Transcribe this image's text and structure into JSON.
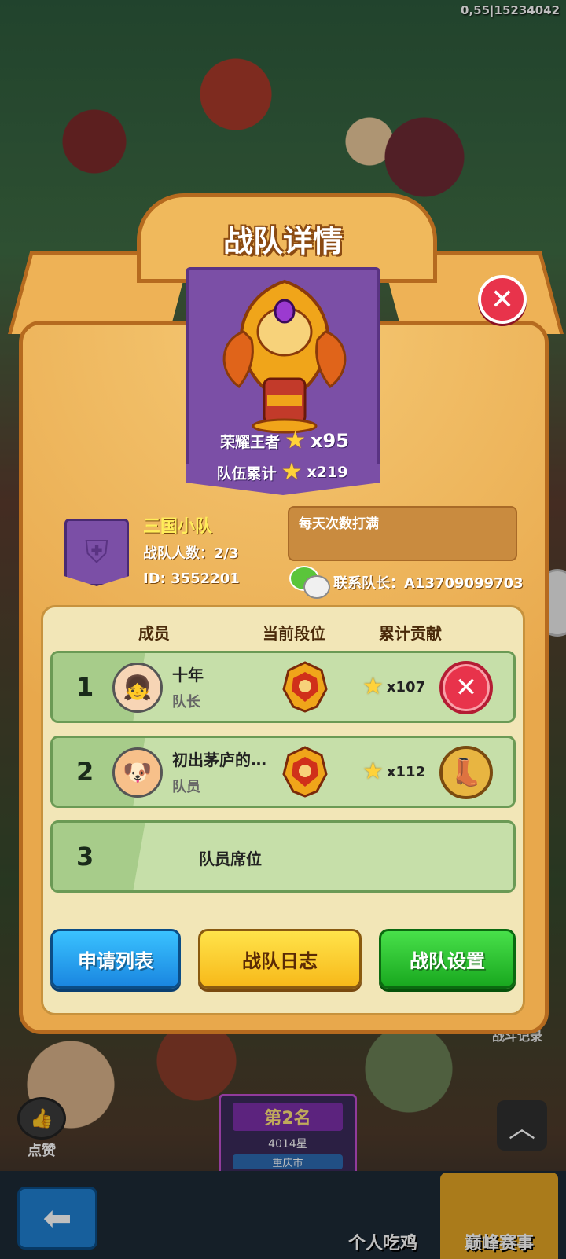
{
  "status": {
    "debug_text": "0,55|15234042"
  },
  "modal": {
    "title": "战队详情",
    "honor": {
      "label": "荣耀王者",
      "count": "x95"
    },
    "team_total": {
      "label": "队伍累计",
      "count": "x219"
    },
    "team": {
      "name": "三国小队",
      "member_count": "战队人数：2/3",
      "id": "ID: 3552201",
      "notice": "每天次数打满",
      "contact": "联系队长：A13709099703"
    },
    "table": {
      "headers": {
        "member": "成员",
        "rank": "当前段位",
        "contribution": "累计贡献"
      },
      "rows": [
        {
          "num": "1",
          "name": "十年",
          "role": "队长",
          "contribution": "x107",
          "action_icon": "close-icon"
        },
        {
          "num": "2",
          "name": "初出茅庐的…",
          "role": "队员",
          "contribution": "x112",
          "action_icon": "boot-icon"
        }
      ],
      "empty_row": {
        "num": "3",
        "label": "队员席位"
      }
    },
    "buttons": {
      "apply_list": "申请列表",
      "team_log": "战队日志",
      "team_settings": "战队设置"
    }
  },
  "background_ui": {
    "like_label": "点赞",
    "rank_title": "第2名",
    "rank_stars": "4014星",
    "rank_city": "重庆市",
    "record_label": "战斗记录",
    "tab_personal": "个人吃鸡",
    "tab_peak": "巅峰赛事"
  },
  "colors": {
    "panel": "#e8a84c",
    "banner": "#7b4fa6",
    "row_bg": "#c6dfa9",
    "blue_btn": "#1a86e0",
    "yellow_btn": "#f7b91a",
    "green_btn": "#19a81f",
    "close_red": "#e8334b"
  }
}
